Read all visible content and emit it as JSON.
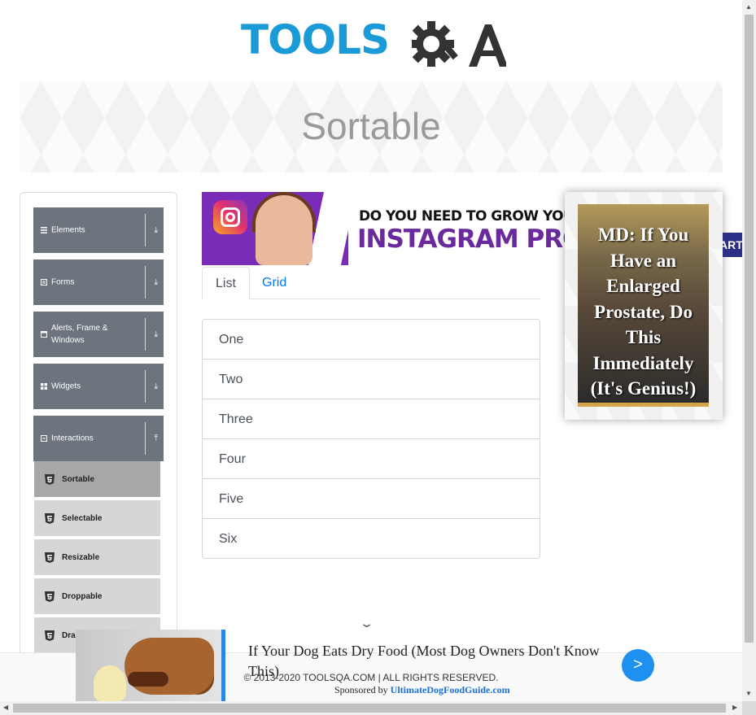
{
  "logo": {
    "tools": "TOOLS",
    "qa": "QA"
  },
  "banner": {
    "title": "Sortable"
  },
  "sidebar": {
    "groups": [
      {
        "label": "Elements",
        "icon": "menu-icon",
        "arrow": "download-arrow-icon"
      },
      {
        "label": "Forms",
        "icon": "form-icon",
        "arrow": "download-arrow-icon"
      },
      {
        "label": "Alerts, Frame & Windows",
        "icon": "window-icon",
        "arrow": "download-arrow-icon"
      },
      {
        "label": "Widgets",
        "icon": "grid-icon",
        "arrow": "download-arrow-icon"
      },
      {
        "label": "Interactions",
        "icon": "interactions-icon",
        "arrow": "upload-arrow-icon"
      }
    ],
    "items": [
      {
        "label": "Sortable",
        "active": true
      },
      {
        "label": "Selectable",
        "active": false
      },
      {
        "label": "Resizable",
        "active": false
      },
      {
        "label": "Droppable",
        "active": false
      },
      {
        "label": "Dragabble",
        "active": false
      }
    ]
  },
  "ad_instagram": {
    "line1": "DO YOU NEED TO GROW YOU",
    "line2": "INSTAGRAM PRO"
  },
  "tabs": [
    {
      "label": "List",
      "active": true
    },
    {
      "label": "Grid",
      "active": false
    }
  ],
  "list_items": [
    "One",
    "Two",
    "Three",
    "Four",
    "Five",
    "Six"
  ],
  "side_ad": {
    "text": "MD: If You Have an Enlarged Prostate, Do This Immediately (It's Genius!)"
  },
  "start_button": {
    "label": "ART"
  },
  "footer": {
    "copyright": "© 2013-2020 TOOLSQA.COM | ALL RIGHTS RESERVED."
  },
  "bottom_ad": {
    "title": "If Your Dog Eats Dry Food (Most Dog Owners Don't Know This)",
    "sponsored_prefix": "Sponsored by",
    "sponsor": "UltimateDogFoodGuide.com",
    "go_label": ">"
  },
  "colors": {
    "brand_blue": "#1a9ad6",
    "group_bg": "#6c757d",
    "active_item_bg": "#a8a8a8",
    "link": "#007bff"
  }
}
